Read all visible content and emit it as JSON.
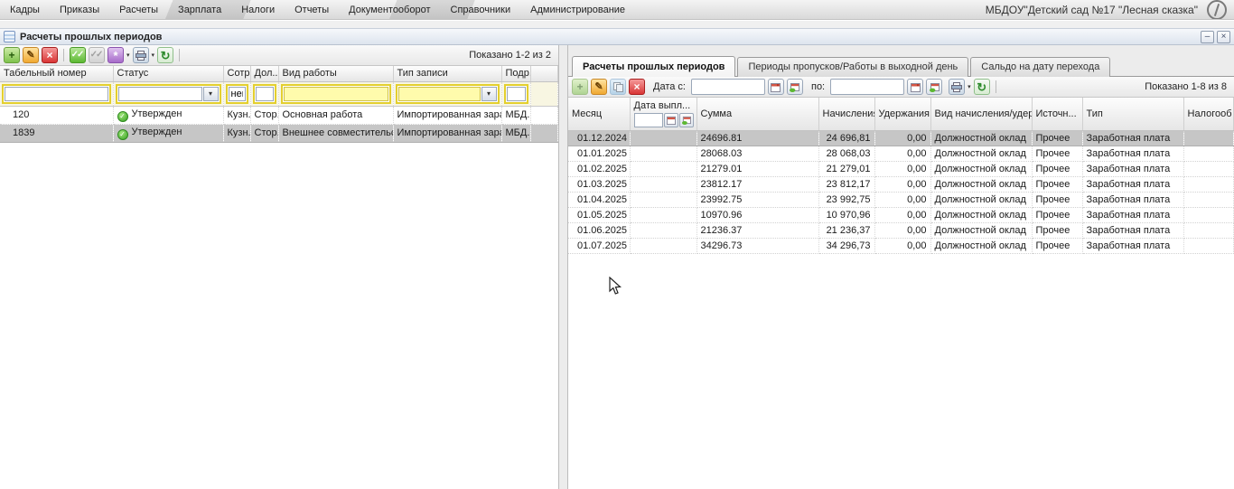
{
  "icons": {
    "add": "+",
    "edit": "✎",
    "delete": "×",
    "approve": "✓✓",
    "unapprove": "✓✓",
    "actions": "*",
    "refresh": "↻",
    "dropdown": "▾",
    "status_approved": "✓",
    "minimize": "–",
    "close": "×"
  },
  "menu_bar": {
    "items": [
      "Кадры",
      "Приказы",
      "Расчеты",
      "Зарплата",
      "Налоги",
      "Отчеты",
      "Документооборот",
      "Справочники",
      "Администрирование"
    ],
    "org_name": "МБДОУ\"Детский сад №17 \"Лесная сказка\""
  },
  "window": {
    "title": "Расчеты прошлых периодов"
  },
  "left_panel": {
    "toolbar": {
      "shown": "Показано 1-2 из 2"
    },
    "table": {
      "columns": [
        "Табельный номер",
        "Статус",
        "Сотр...",
        "Дол...",
        "Вид работы",
        "Тип записи",
        "Подр..."
      ],
      "filter_employee_value": "нецов",
      "rows": [
        [
          "120",
          "Утвержден",
          "Кузн...",
          "Стор...",
          "Основная работа",
          "Импортированная зарабо...",
          "МБД..."
        ],
        [
          "1839",
          "Утвержден",
          "Кузн...",
          "Стор...",
          "Внешнее совместительство",
          "Импортированная зарабо...",
          "МБД..."
        ]
      ],
      "selected_row_index": 1
    }
  },
  "right_panel": {
    "tabs": [
      "Расчеты прошлых периодов",
      "Периоды пропусков/Работы в выходной день",
      "Сальдо на дату перехода"
    ],
    "active_tab_index": 0,
    "toolbar": {
      "date_from_label": "Дата с:",
      "date_to_label": "по:",
      "date_from_value": "",
      "date_to_value": "",
      "shown": "Показано 1-8 из 8"
    },
    "table": {
      "columns": [
        "Месяц",
        "Дата выпл...",
        "Сумма",
        "Начисления",
        "Удержания",
        "Вид начисления/удержания",
        "Источн...",
        "Тип",
        "Налогооб"
      ],
      "rows": [
        [
          "01.12.2024",
          "",
          "24696.81",
          "24 696,81",
          "0,00",
          "Должностной оклад",
          "Прочее",
          "Заработная плата",
          ""
        ],
        [
          "01.01.2025",
          "",
          "28068.03",
          "28 068,03",
          "0,00",
          "Должностной оклад",
          "Прочее",
          "Заработная плата",
          ""
        ],
        [
          "01.02.2025",
          "",
          "21279.01",
          "21 279,01",
          "0,00",
          "Должностной оклад",
          "Прочее",
          "Заработная плата",
          ""
        ],
        [
          "01.03.2025",
          "",
          "23812.17",
          "23 812,17",
          "0,00",
          "Должностной оклад",
          "Прочее",
          "Заработная плата",
          ""
        ],
        [
          "01.04.2025",
          "",
          "23992.75",
          "23 992,75",
          "0,00",
          "Должностной оклад",
          "Прочее",
          "Заработная плата",
          ""
        ],
        [
          "01.05.2025",
          "",
          "10970.96",
          "10 970,96",
          "0,00",
          "Должностной оклад",
          "Прочее",
          "Заработная плата",
          ""
        ],
        [
          "01.06.2025",
          "",
          "21236.37",
          "21 236,37",
          "0,00",
          "Должностной оклад",
          "Прочее",
          "Заработная плата",
          ""
        ],
        [
          "01.07.2025",
          "",
          "34296.73",
          "34 296,73",
          "0,00",
          "Должностной оклад",
          "Прочее",
          "Заработная плата",
          ""
        ]
      ],
      "selected_row_index": 0
    }
  }
}
